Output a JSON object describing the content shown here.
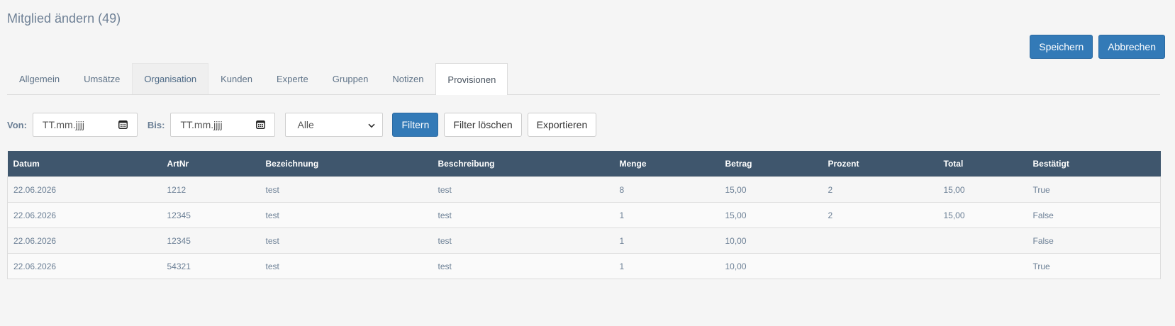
{
  "page": {
    "title": "Mitglied ändern (49)"
  },
  "actions": {
    "save": "Speichern",
    "cancel": "Abbrechen"
  },
  "tabs": [
    {
      "label": "Allgemein",
      "state": "normal"
    },
    {
      "label": "Umsätze",
      "state": "normal"
    },
    {
      "label": "Organisation",
      "state": "muted"
    },
    {
      "label": "Kunden",
      "state": "normal"
    },
    {
      "label": "Experte",
      "state": "normal"
    },
    {
      "label": "Gruppen",
      "state": "normal"
    },
    {
      "label": "Notizen",
      "state": "normal"
    },
    {
      "label": "Provisionen",
      "state": "active"
    }
  ],
  "filters": {
    "from_label": "Von:",
    "from_placeholder": "TT.mm.jjjj",
    "to_label": "Bis:",
    "to_placeholder": "TT.mm.jjjj",
    "status_selected": "Alle",
    "filter_button": "Filtern",
    "clear_button": "Filter löschen",
    "export_button": "Exportieren"
  },
  "table": {
    "columns": [
      "Datum",
      "ArtNr",
      "Bezeichnung",
      "Beschreibung",
      "Menge",
      "Betrag",
      "Prozent",
      "Total",
      "Bestätigt"
    ],
    "rows": [
      [
        "22.06.2026",
        "1212",
        "test",
        "test",
        "8",
        "15,00",
        "2",
        "15,00",
        "True"
      ],
      [
        "22.06.2026",
        "12345",
        "test",
        "test",
        "1",
        "15,00",
        "2",
        "15,00",
        "False"
      ],
      [
        "22.06.2026",
        "12345",
        "test",
        "test",
        "1",
        "10,00",
        "",
        "",
        "False"
      ],
      [
        "22.06.2026",
        "54321",
        "test",
        "test",
        "1",
        "10,00",
        "",
        "",
        "True"
      ]
    ]
  },
  "colors": {
    "primary": "#337ab7",
    "table_header": "#3f566d",
    "text": "#6b7f95"
  },
  "icons": {
    "date_picker": "calendar-icon",
    "select_arrow": "chevron-down-icon"
  }
}
